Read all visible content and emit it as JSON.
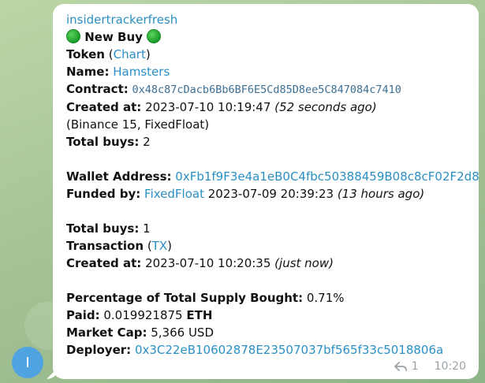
{
  "avatar": {
    "letter": "I"
  },
  "message": {
    "sender": "insidertrackerfresh",
    "headline": "New Buy",
    "token_label": "Token",
    "paren_open": "(",
    "paren_close": ")",
    "chart_link": "Chart",
    "name_label": "Name:",
    "name_value": "Hamsters",
    "contract_label": "Contract:",
    "contract_value": "0x48c87cDacb6Bb6BF6E5Cd85D8ee5C847084c7410",
    "created_label": "Created at:",
    "created_value": "2023-07-10 10:19:47",
    "created_relative": "(52 seconds ago)",
    "sources": "(Binance 15, FixedFloat)",
    "total_buys_label": "Total buys:",
    "total_buys_value": "2",
    "wallet_label": "Wallet Address:",
    "wallet_value": "0xFb1f9F3e4a1eB0C4fbc50388459B08c8cF02F2d8",
    "funded_label": "Funded by:",
    "funded_link": "FixedFloat",
    "funded_time": "2023-07-09 20:39:23",
    "funded_relative": "(13 hours ago)",
    "wallet_total_buys_label": "Total buys:",
    "wallet_total_buys_value": "1",
    "transaction_label": "Transaction",
    "tx_link": "TX",
    "tx_created_label": "Created at:",
    "tx_created_value": "2023-07-10 10:20:35",
    "tx_created_relative": "(just now)",
    "pct_label": "Percentage of Total Supply Bought:",
    "pct_value": "0.71%",
    "paid_label": "Paid:",
    "paid_value": "0.019921875",
    "paid_unit": "ETH",
    "mcap_label": "Market Cap:",
    "mcap_value": "5,366 USD",
    "deployer_label": "Deployer:",
    "deployer_value": "0x3C22eB10602878E23507037bf565f33c5018806a"
  },
  "meta": {
    "reply_count": "1",
    "time": "10:20"
  },
  "colors": {
    "link": "#2b8fc4",
    "indicator": "#1c9c2a",
    "avatar": "#4fa3e0"
  }
}
